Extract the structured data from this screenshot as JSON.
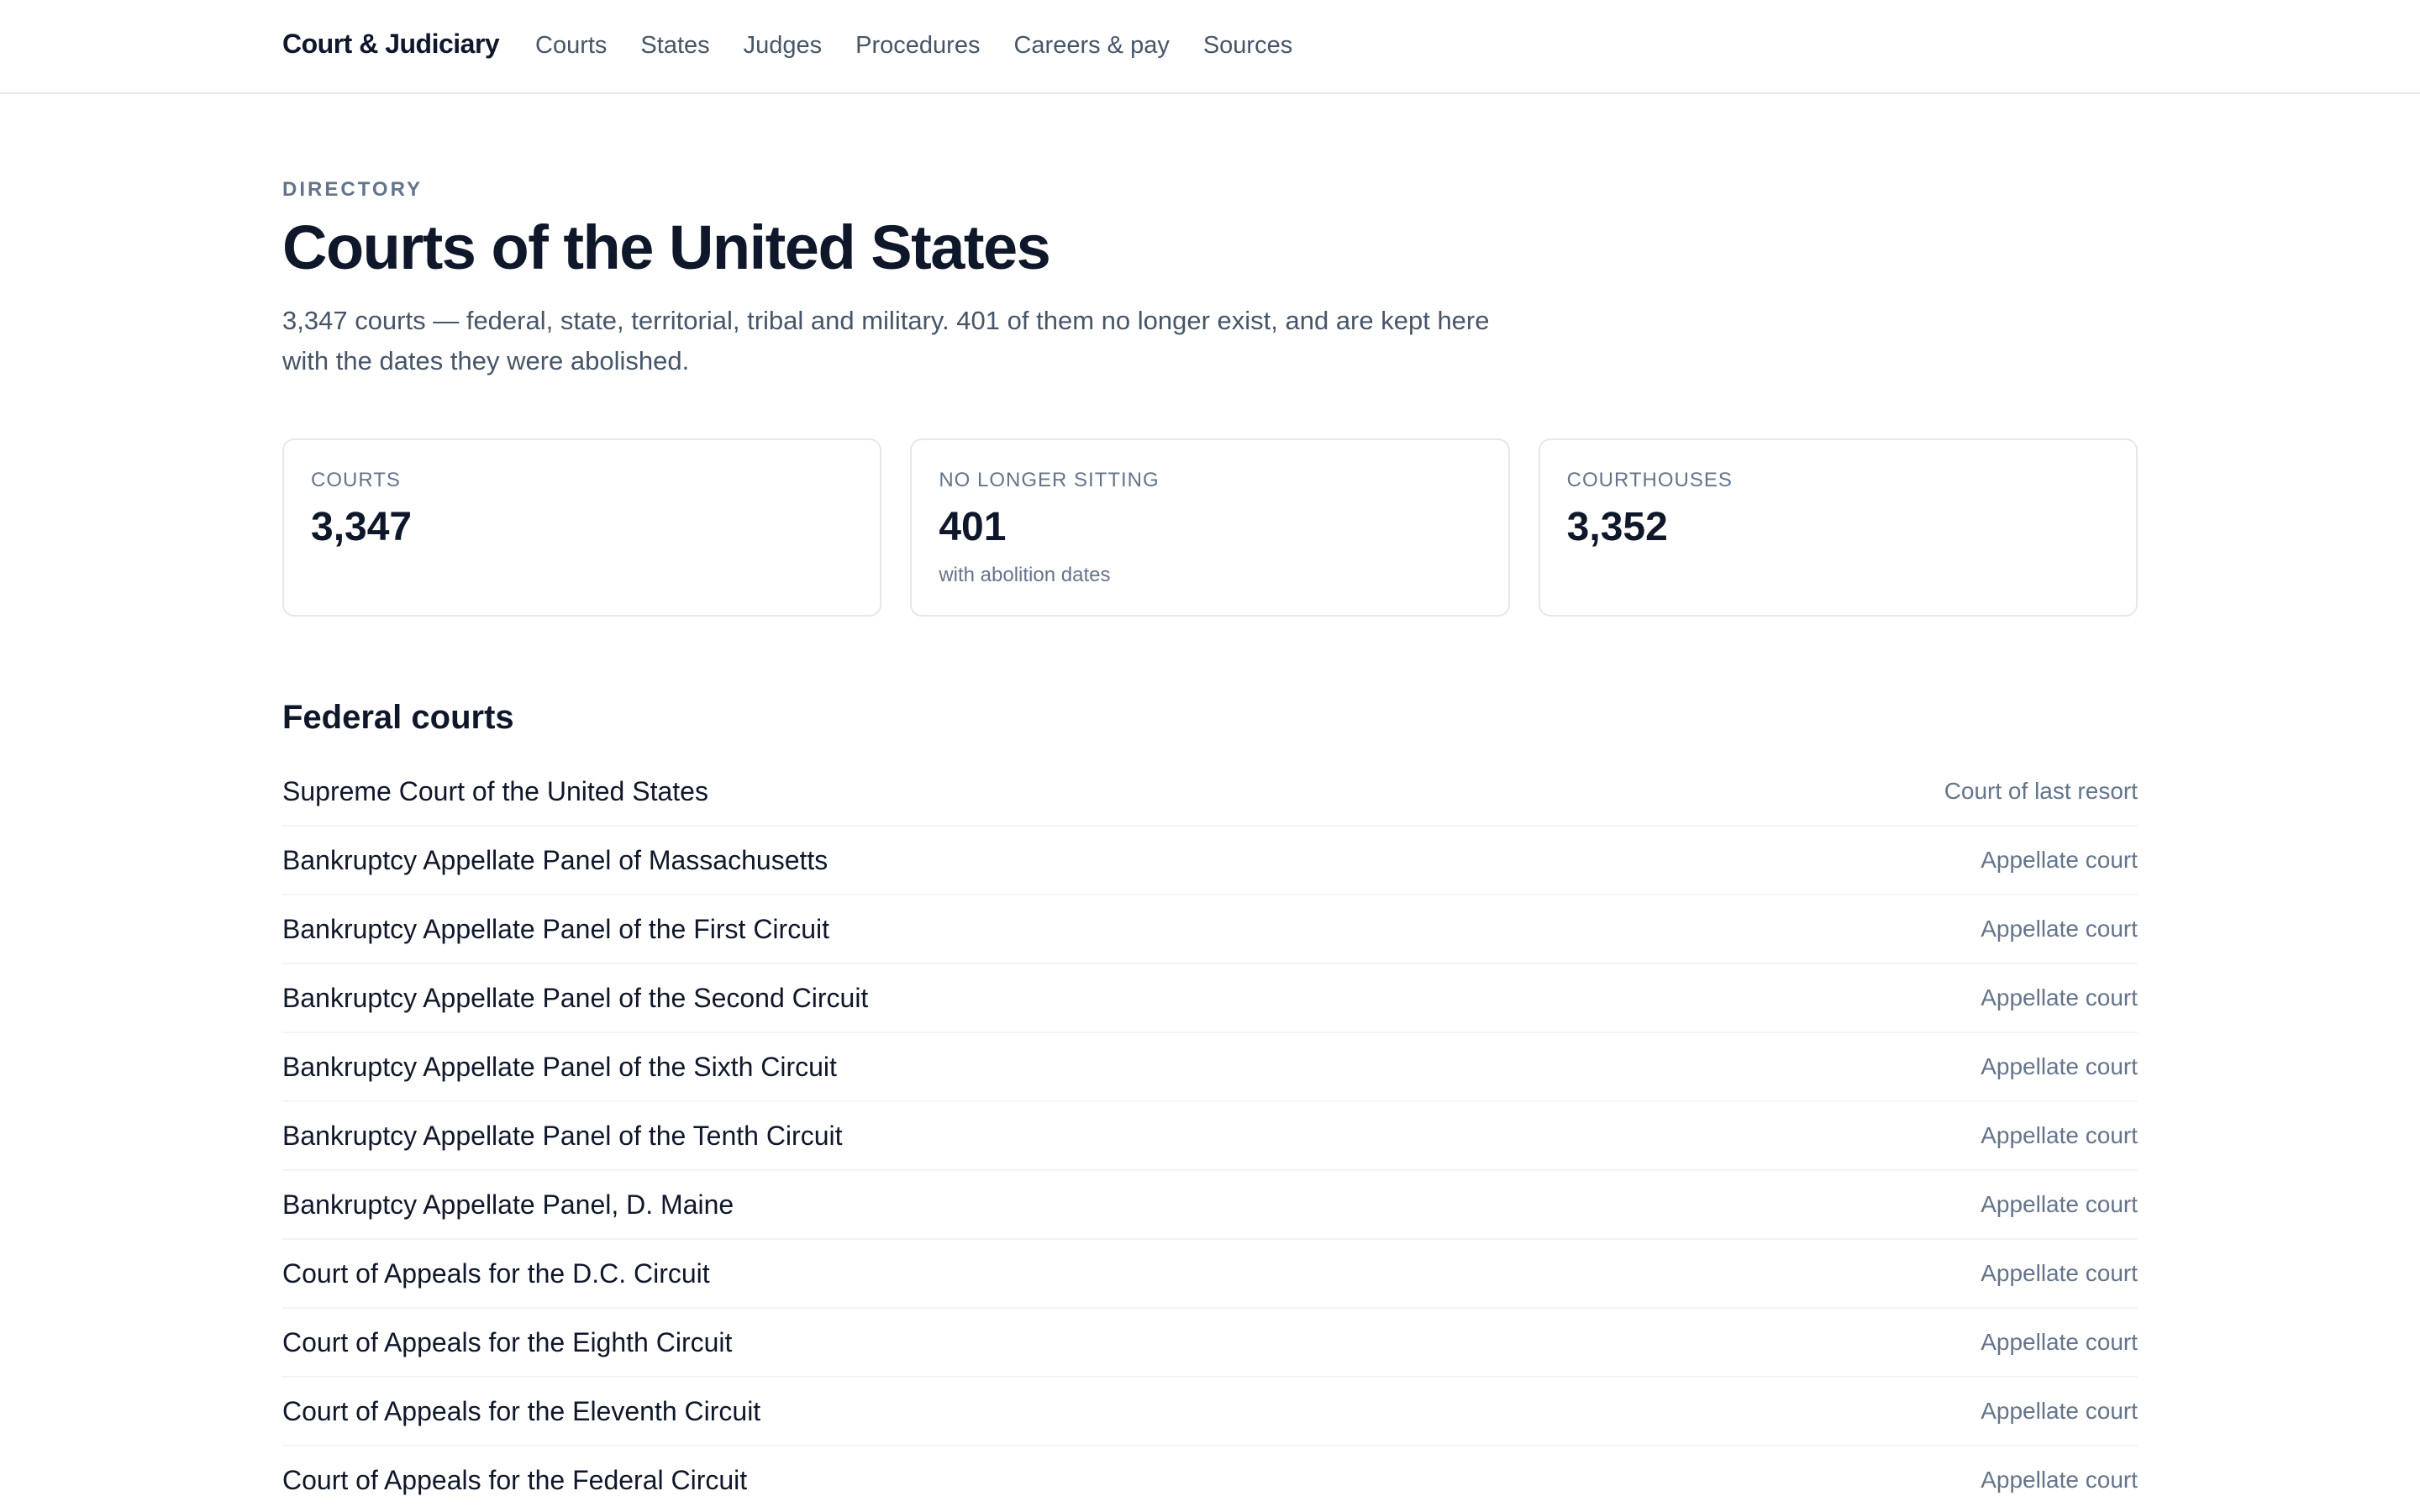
{
  "nav": {
    "brand": "Court & Judiciary",
    "links": [
      "Courts",
      "States",
      "Judges",
      "Procedures",
      "Careers & pay",
      "Sources"
    ]
  },
  "header": {
    "eyebrow": "DIRECTORY",
    "title": "Courts of the United States",
    "intro": "3,347 courts — federal, state, territorial, tribal and military. 401 of them no longer exist, and are kept here with the dates they were abolished."
  },
  "stats": [
    {
      "label": "COURTS",
      "value": "3,347",
      "note": ""
    },
    {
      "label": "NO LONGER SITTING",
      "value": "401",
      "note": "with abolition dates"
    },
    {
      "label": "COURTHOUSES",
      "value": "3,352",
      "note": ""
    }
  ],
  "federal": {
    "title": "Federal courts",
    "courts": [
      {
        "name": "Supreme Court of the United States",
        "type": "Court of last resort"
      },
      {
        "name": "Bankruptcy Appellate Panel of Massachusetts",
        "type": "Appellate court"
      },
      {
        "name": "Bankruptcy Appellate Panel of the First Circuit",
        "type": "Appellate court"
      },
      {
        "name": "Bankruptcy Appellate Panel of the Second Circuit",
        "type": "Appellate court"
      },
      {
        "name": "Bankruptcy Appellate Panel of the Sixth Circuit",
        "type": "Appellate court"
      },
      {
        "name": "Bankruptcy Appellate Panel of the Tenth Circuit",
        "type": "Appellate court"
      },
      {
        "name": "Bankruptcy Appellate Panel, D. Maine",
        "type": "Appellate court"
      },
      {
        "name": "Court of Appeals for the D.C. Circuit",
        "type": "Appellate court"
      },
      {
        "name": "Court of Appeals for the Eighth Circuit",
        "type": "Appellate court"
      },
      {
        "name": "Court of Appeals for the Eleventh Circuit",
        "type": "Appellate court"
      },
      {
        "name": "Court of Appeals for the Federal Circuit",
        "type": "Appellate court"
      }
    ]
  }
}
